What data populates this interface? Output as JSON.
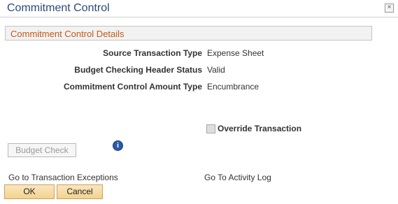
{
  "window": {
    "title": "Commitment Control",
    "close_symbol": "×"
  },
  "section": {
    "title": "Commitment Control Details"
  },
  "fields": [
    {
      "label": "Source Transaction Type",
      "value": "Expense Sheet"
    },
    {
      "label": "Budget Checking Header Status",
      "value": "Valid"
    },
    {
      "label": "Commitment Control Amount Type",
      "value": "Encumbrance"
    }
  ],
  "override": {
    "label": "Override Transaction",
    "checked": false,
    "disabled": true
  },
  "actions": {
    "budget_check_label": "Budget Check",
    "info_symbol": "i",
    "transaction_exceptions_link": "Go to Transaction Exceptions",
    "activity_log_link": "Go To Activity Log",
    "ok_label": "OK",
    "cancel_label": "Cancel"
  },
  "icons": {
    "close": "close-icon",
    "info": "info-icon"
  },
  "colors": {
    "title": "#2b4a7a",
    "section_title": "#c05a14",
    "button_bg": "#f2d28e",
    "info_icon": "#2c5aa8"
  }
}
